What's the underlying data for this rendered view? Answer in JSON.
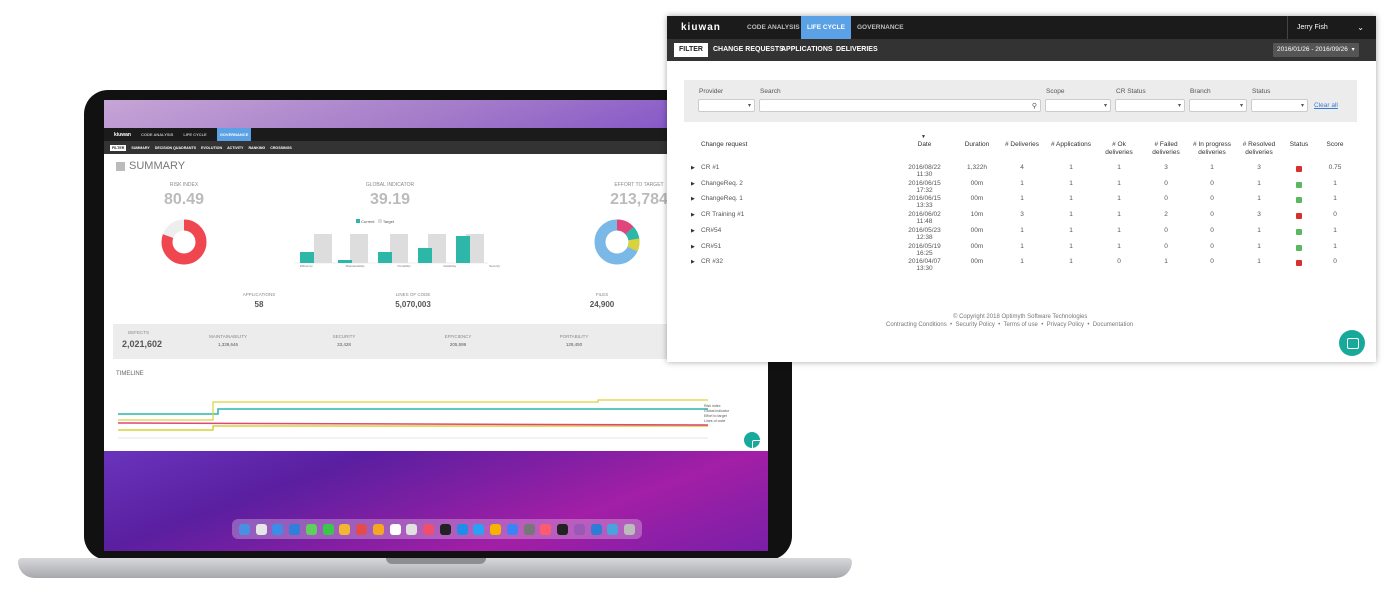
{
  "laptop": {
    "nav": {
      "logo": "kiuwan",
      "tabs": [
        "CODE ANALYSIS",
        "LIFE CYCLE",
        "GOVERNANCE"
      ]
    },
    "subnav": [
      "FILTER",
      "SUMMARY",
      "DECISION QUADRANTS",
      "EVOLUTION",
      "ACTIVITY",
      "RANKING",
      "CROSSINGS"
    ],
    "summary_title": "SUMMARY",
    "kpis": [
      {
        "label": "RISK INDEX",
        "value": "80.49"
      },
      {
        "label": "GLOBAL INDICATOR",
        "value": "39.19"
      },
      {
        "label": "EFFORT TO TARGET",
        "value": "213,784"
      }
    ],
    "legend": {
      "current": "Current",
      "target": "Target"
    },
    "bar_categories": [
      "Efficiency",
      "Maintainability",
      "Portability",
      "Reliability",
      "Security"
    ],
    "counts": [
      {
        "label": "APPLICATIONS",
        "value": "58"
      },
      {
        "label": "LINES OF CODE",
        "value": "5,070,003"
      },
      {
        "label": "FILES",
        "value": "24,900"
      }
    ],
    "defects": [
      {
        "label": "DEFECTS",
        "value": "2,021,602"
      },
      {
        "label": "MAINTAINABILITY",
        "value": "1,339,646"
      },
      {
        "label": "SECURITY",
        "value": "33,428"
      },
      {
        "label": "EFFICIENCY",
        "value": "205,599"
      },
      {
        "label": "PORTABILITY",
        "value": "129,450"
      }
    ],
    "timeline_title": "TIMELINE",
    "timeline_legend": [
      "Risk index",
      "Global indicator",
      "Effort to target",
      "Lines of code"
    ]
  },
  "app": {
    "nav": {
      "logo": "kiuwan",
      "tabs": [
        "CODE ANALYSIS",
        "LIFE CYCLE",
        "GOVERNANCE"
      ],
      "active_tab": "LIFE CYCLE",
      "user": "Jerry Fish"
    },
    "subnav": {
      "filter": "FILTER",
      "tabs": [
        "CHANGE REQUESTS",
        "APPLICATIONS",
        "DELIVERIES"
      ],
      "date_range": "2016/01/26 - 2016/09/26"
    },
    "filters": {
      "provider": "Provider",
      "search": "Search",
      "scope": "Scope",
      "cr_status": "CR Status",
      "branch": "Branch",
      "status": "Status",
      "clear_all": "Clear all"
    },
    "table": {
      "headers": [
        "Change request",
        "Date",
        "Duration",
        "# Deliveries",
        "# Applications",
        "# Ok deliveries",
        "# Failed deliveries",
        "# In progress deliveries",
        "# Resolved deliveries",
        "Status",
        "Score"
      ],
      "rows": [
        {
          "name": "CR #1",
          "date": "2016/08/22 11:30",
          "duration": "1,322h",
          "deliveries": "4",
          "applications": "1",
          "ok": "1",
          "failed": "3",
          "in_progress": "1",
          "resolved": "3",
          "status": "down",
          "score": "0.75"
        },
        {
          "name": "ChangeReq. 2",
          "date": "2016/06/15 17:32",
          "duration": "00m",
          "deliveries": "1",
          "applications": "1",
          "ok": "1",
          "failed": "0",
          "in_progress": "0",
          "resolved": "1",
          "status": "up",
          "score": "1"
        },
        {
          "name": "ChangeReq. 1",
          "date": "2016/06/15 13:33",
          "duration": "00m",
          "deliveries": "1",
          "applications": "1",
          "ok": "1",
          "failed": "0",
          "in_progress": "0",
          "resolved": "1",
          "status": "up",
          "score": "1"
        },
        {
          "name": "CR Training #1",
          "date": "2016/06/02 11:48",
          "duration": "10m",
          "deliveries": "3",
          "applications": "1",
          "ok": "1",
          "failed": "2",
          "in_progress": "0",
          "resolved": "3",
          "status": "down",
          "score": "0"
        },
        {
          "name": "CR#54",
          "date": "2016/05/23 12:38",
          "duration": "00m",
          "deliveries": "1",
          "applications": "1",
          "ok": "1",
          "failed": "0",
          "in_progress": "0",
          "resolved": "1",
          "status": "up",
          "score": "1"
        },
        {
          "name": "CR#51",
          "date": "2016/05/19 16:25",
          "duration": "00m",
          "deliveries": "1",
          "applications": "1",
          "ok": "1",
          "failed": "0",
          "in_progress": "0",
          "resolved": "1",
          "status": "up",
          "score": "1"
        },
        {
          "name": "CR #32",
          "date": "2016/04/07 13:30",
          "duration": "00m",
          "deliveries": "1",
          "applications": "1",
          "ok": "0",
          "failed": "1",
          "in_progress": "0",
          "resolved": "1",
          "status": "down",
          "score": "0"
        }
      ]
    },
    "footer": {
      "copyright": "© Copyright 2018 Optimyth Software Technologies",
      "links": [
        "Contracting Conditions",
        "Security Policy",
        "Terms of use",
        "Privacy Policy",
        "Documentation"
      ]
    }
  }
}
